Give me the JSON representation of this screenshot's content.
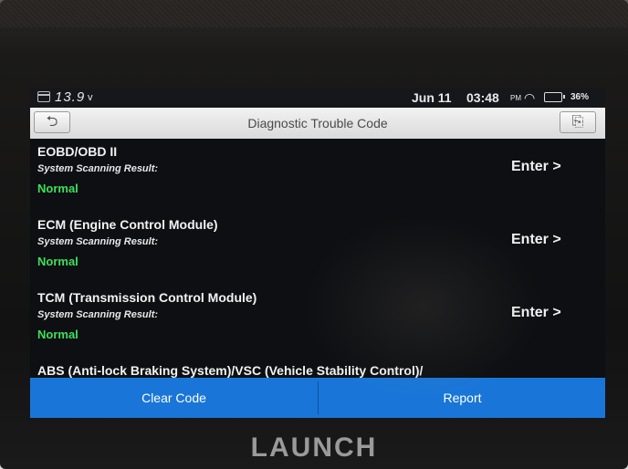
{
  "status": {
    "voltage": "13.9",
    "voltage_unit": "v",
    "date": "Jun 11",
    "time": "03:48",
    "ampm": "PM",
    "battery": "36%"
  },
  "header": {
    "title": "Diagnostic Trouble Code"
  },
  "systems": [
    {
      "name": "EOBD/OBD II",
      "label": "System Scanning Result:",
      "status": "Normal",
      "action": "Enter >"
    },
    {
      "name": "ECM (Engine Control Module)",
      "label": "System Scanning Result:",
      "status": "Normal",
      "action": "Enter >"
    },
    {
      "name": "TCM (Transmission Control Module)",
      "label": "System Scanning Result:",
      "status": "Normal",
      "action": "Enter >"
    },
    {
      "name": "ABS (Anti-lock Braking System)/VSC (Vehicle Stability Control)/"
    }
  ],
  "footer": {
    "clear_label": "Clear Code",
    "report_label": "Report"
  },
  "brand": "LAUNCH",
  "colors": {
    "accent": "#1976d8",
    "normal": "#3ee05a"
  }
}
